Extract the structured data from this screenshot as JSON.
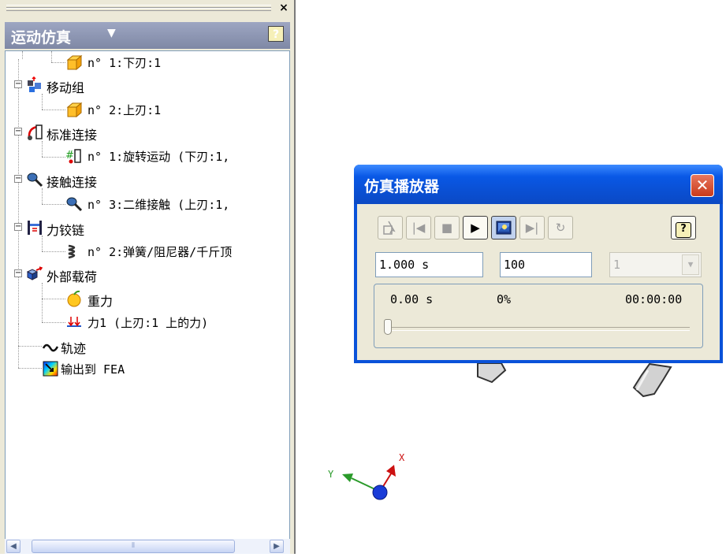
{
  "panel": {
    "title": "运动仿真",
    "dropdown_icon": "caret-down",
    "help_label": "?",
    "close_label": "×"
  },
  "tree": [
    {
      "label": "n° 1:下刃:1",
      "icon": "part-cube-icon"
    },
    {
      "label": "移动组",
      "icon": "moving-group-icon"
    },
    {
      "label": "n° 2:上刃:1",
      "icon": "part-cube-icon"
    },
    {
      "label": "标准连接",
      "icon": "standard-joint-icon"
    },
    {
      "label": "n° 1:旋转运动 (下刃:1, ",
      "icon": "revolute-joint-icon"
    },
    {
      "label": "接触连接",
      "icon": "contact-joint-icon"
    },
    {
      "label": "n° 3:二维接触 (上刃:1, ",
      "icon": "contact-2d-icon"
    },
    {
      "label": "力铰链",
      "icon": "force-joint-icon"
    },
    {
      "label": "n° 2:弹簧/阻尼器/千斤顶",
      "icon": "spring-icon"
    },
    {
      "label": "外部载荷",
      "icon": "external-load-icon"
    },
    {
      "label": "重力",
      "icon": "gravity-apple-icon"
    },
    {
      "label": "力1 (上刃:1 上的力)",
      "icon": "force-arrow-icon"
    },
    {
      "label": "轨迹",
      "icon": "trajectory-icon"
    },
    {
      "label": "输出到 FEA",
      "icon": "export-fea-icon"
    }
  ],
  "dialog": {
    "title": "仿真播放器",
    "close_label": "✕",
    "help_label": "?",
    "toolbar": [
      "construct-mode-icon",
      "rewind-icon",
      "stop-icon",
      "play-icon",
      "screen-refresh-icon",
      "forward-end-icon",
      "replay-icon"
    ],
    "end_time": "1.000 s",
    "images": "100",
    "step": "1",
    "time": "0.00 s",
    "percent": "0%",
    "clock": "00:00:00",
    "progress": 0
  },
  "triad": {
    "x_label": "X",
    "y_label": "Y"
  },
  "colors": {
    "title_blue": "#0a52d9",
    "panel_header": "#8a93b0",
    "close_red": "#d2492a"
  }
}
